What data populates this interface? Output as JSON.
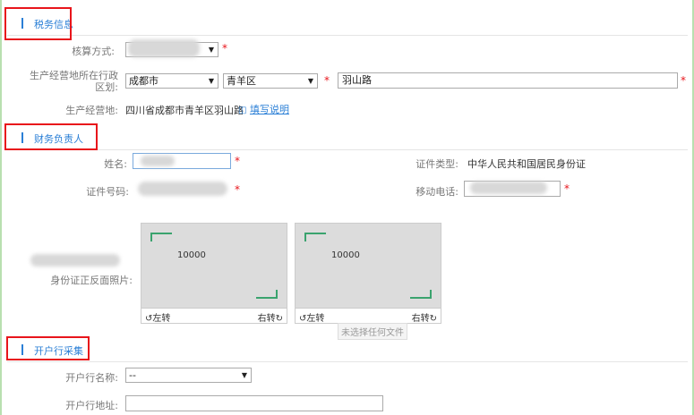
{
  "sections": {
    "tax": {
      "title": "税务信息"
    },
    "finance": {
      "title": "财务负责人"
    },
    "bank": {
      "title": "开户行采集"
    }
  },
  "tax": {
    "method_label": "核算方式:",
    "region_label": "生产经营地所在行政区划:",
    "city": "成都市",
    "district": "青羊区",
    "street": "羽山路",
    "address_label": "生产经营地:",
    "address_value": "四川省成都市青羊区羽山路",
    "fill_link": "填写说明"
  },
  "finance": {
    "name_label": "姓名:",
    "id_type_label": "证件类型:",
    "id_type_value": "中华人民共和国居民身份证",
    "id_no_label": "证件号码:",
    "phone_label": "移动电话:",
    "photo_label": "身份证正反面照片:",
    "photo1_value": "10000",
    "photo2_value": "10000",
    "rotate_left": "左转",
    "rotate_right": "右转",
    "no_file_tip": "未选择任何文件"
  },
  "bank": {
    "name_label": "开户行名称:",
    "name_value": "--",
    "address_label": "开户行地址:"
  },
  "required_mark": "*",
  "colors": {
    "accent": "#2b7fd6",
    "required": "#e8151b",
    "highlight_box": "#e8151b"
  }
}
